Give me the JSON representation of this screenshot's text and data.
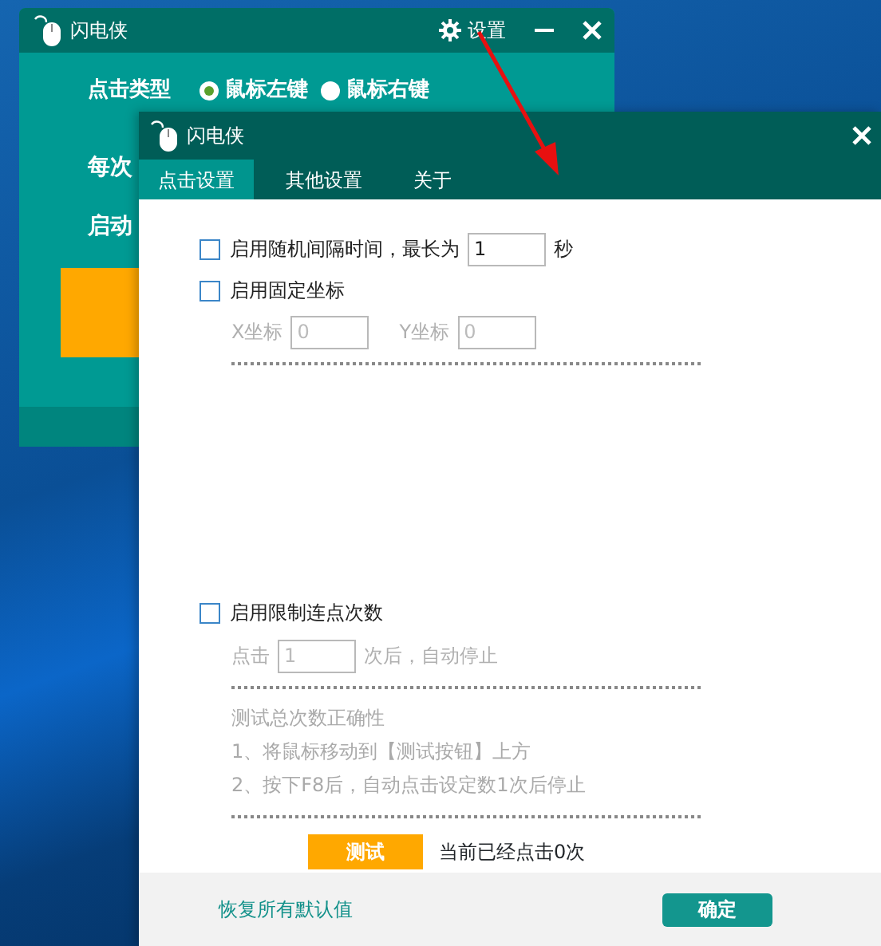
{
  "back_window": {
    "title": "闪电侠",
    "settings_label": "设置",
    "click_type": {
      "label": "点击类型",
      "options": [
        {
          "label": "鼠标左键",
          "selected": true
        },
        {
          "label": "鼠标右键",
          "selected": false
        }
      ]
    },
    "row_labels": [
      "每次",
      "启动"
    ]
  },
  "front_window": {
    "title": "闪电侠",
    "tabs": [
      {
        "label": "点击设置",
        "selected": true
      },
      {
        "label": "其他设置",
        "selected": false
      },
      {
        "label": "关于",
        "selected": false
      }
    ],
    "random_interval": {
      "label": "启用随机间隔时间，最长为",
      "checked": false,
      "value": "1",
      "unit": "秒"
    },
    "fixed_coords": {
      "label": "启用固定坐标",
      "checked": false,
      "disabled": true,
      "x_label": "X坐标",
      "x_value": "0",
      "y_label": "Y坐标",
      "y_value": "0"
    },
    "limit": {
      "label": "启用限制连点次数",
      "checked": false,
      "disabled": true,
      "prefix": "点击",
      "value": "1",
      "suffix": "次后，自动停止"
    },
    "test_info": [
      "测试总次数正确性",
      "1、将鼠标移动到【测试按钮】上方",
      "2、按下F8后，自动点击设定数1次后停止"
    ],
    "test_button": "测试",
    "click_count": "当前已经点击0次",
    "footer": {
      "restore_link": "恢复所有默认值",
      "ok_button": "确定"
    }
  }
}
